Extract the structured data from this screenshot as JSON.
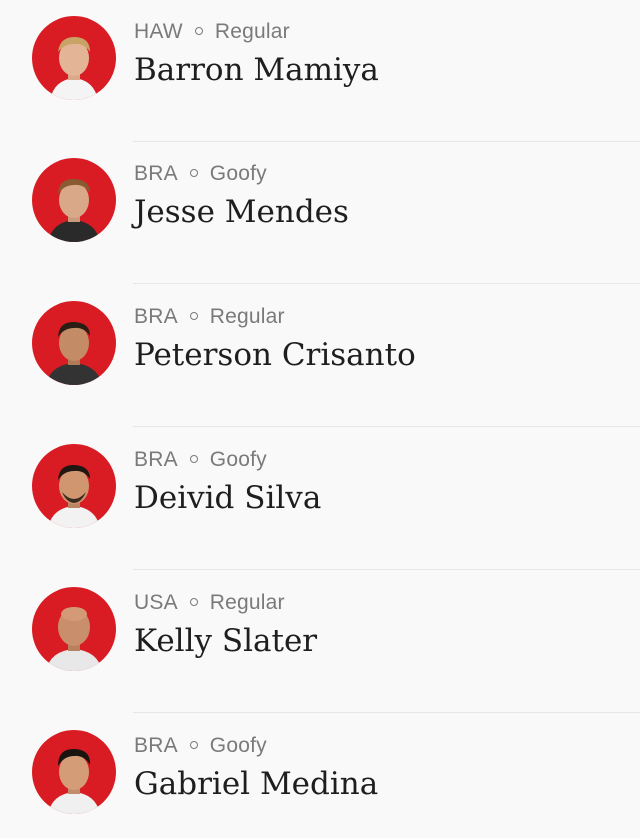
{
  "colors": {
    "avatar_background": "#d91c24",
    "divider": "#e6e6e6",
    "meta_text": "#7a7a7a",
    "name_text": "#1e1e1e"
  },
  "athletes": [
    {
      "country": "HAW",
      "stance": "Regular",
      "name": "Barron Mamiya",
      "avatar_icon": "athlete-photo"
    },
    {
      "country": "BRA",
      "stance": "Goofy",
      "name": "Jesse Mendes",
      "avatar_icon": "athlete-photo"
    },
    {
      "country": "BRA",
      "stance": "Regular",
      "name": "Peterson Crisanto",
      "avatar_icon": "athlete-photo"
    },
    {
      "country": "BRA",
      "stance": "Goofy",
      "name": "Deivid Silva",
      "avatar_icon": "athlete-photo"
    },
    {
      "country": "USA",
      "stance": "Regular",
      "name": "Kelly Slater",
      "avatar_icon": "athlete-photo"
    },
    {
      "country": "BRA",
      "stance": "Goofy",
      "name": "Gabriel Medina",
      "avatar_icon": "athlete-photo"
    }
  ]
}
